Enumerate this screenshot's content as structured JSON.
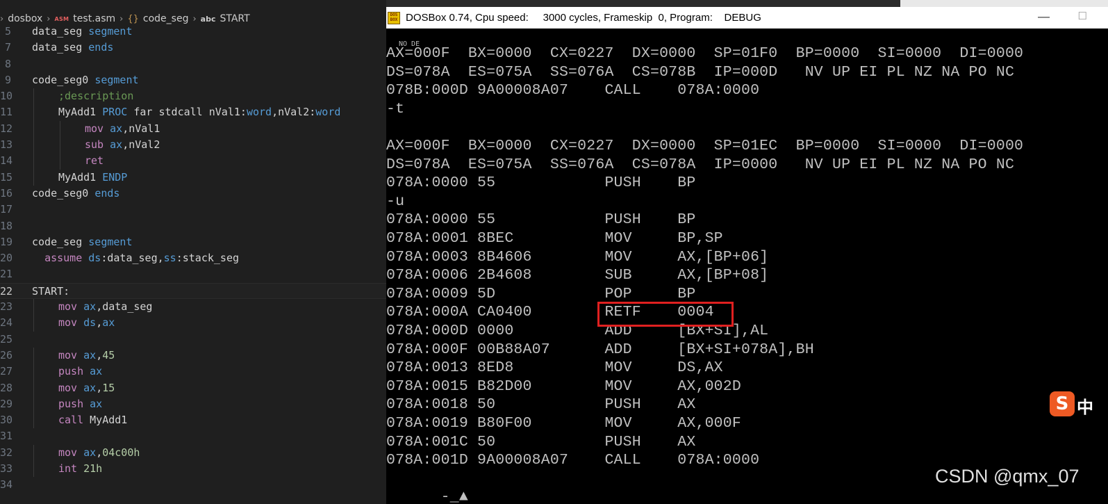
{
  "editor": {
    "breadcrumb": {
      "folder": "dosbox",
      "file_badge": "ASM",
      "file": "test.asm",
      "segment": "code_seg",
      "symbol_badge": "abc",
      "symbol": "START"
    },
    "lines": [
      {
        "num": "5",
        "indent": 0,
        "tokens": [
          {
            "t": "data_seg ",
            "c": "plain"
          },
          {
            "t": "segment",
            "c": "kw"
          }
        ]
      },
      {
        "num": "7",
        "indent": 0,
        "tokens": [
          {
            "t": "data_seg ",
            "c": "plain"
          },
          {
            "t": "ends",
            "c": "kw"
          }
        ]
      },
      {
        "num": "8",
        "indent": 0,
        "tokens": []
      },
      {
        "num": "9",
        "indent": 0,
        "tokens": [
          {
            "t": "code_seg0 ",
            "c": "plain"
          },
          {
            "t": "segment",
            "c": "kw"
          }
        ]
      },
      {
        "num": "10",
        "indent": 1,
        "tokens": [
          {
            "t": ";description",
            "c": "cmt"
          }
        ]
      },
      {
        "num": "11",
        "indent": 1,
        "tokens": [
          {
            "t": "MyAdd1 ",
            "c": "plain"
          },
          {
            "t": "PROC",
            "c": "kw"
          },
          {
            "t": " far stdcall nVal1:",
            "c": "plain"
          },
          {
            "t": "word",
            "c": "kw"
          },
          {
            "t": ",nVal2:",
            "c": "plain"
          },
          {
            "t": "word",
            "c": "kw"
          }
        ]
      },
      {
        "num": "12",
        "indent": 2,
        "tokens": [
          {
            "t": "mov ",
            "c": "ins"
          },
          {
            "t": "ax",
            "c": "reg"
          },
          {
            "t": ",nVal1",
            "c": "plain"
          }
        ]
      },
      {
        "num": "13",
        "indent": 2,
        "tokens": [
          {
            "t": "sub ",
            "c": "ins"
          },
          {
            "t": "ax",
            "c": "reg"
          },
          {
            "t": ",nVal2",
            "c": "plain"
          }
        ]
      },
      {
        "num": "14",
        "indent": 2,
        "tokens": [
          {
            "t": "ret",
            "c": "ins"
          }
        ]
      },
      {
        "num": "15",
        "indent": 1,
        "tokens": [
          {
            "t": "MyAdd1 ",
            "c": "plain"
          },
          {
            "t": "ENDP",
            "c": "kw"
          }
        ]
      },
      {
        "num": "16",
        "indent": 0,
        "tokens": [
          {
            "t": "code_seg0 ",
            "c": "plain"
          },
          {
            "t": "ends",
            "c": "kw"
          }
        ]
      },
      {
        "num": "17",
        "indent": 0,
        "tokens": []
      },
      {
        "num": "18",
        "indent": 0,
        "tokens": []
      },
      {
        "num": "19",
        "indent": 0,
        "tokens": [
          {
            "t": "code_seg ",
            "c": "plain"
          },
          {
            "t": "segment",
            "c": "kw"
          }
        ]
      },
      {
        "num": "20",
        "indent": 0,
        "tokens": [
          {
            "t": "  ",
            "c": "plain"
          },
          {
            "t": "assume ",
            "c": "ins"
          },
          {
            "t": "ds",
            "c": "reg"
          },
          {
            "t": ":data_seg,",
            "c": "plain"
          },
          {
            "t": "ss",
            "c": "reg"
          },
          {
            "t": ":stack_seg",
            "c": "plain"
          }
        ]
      },
      {
        "num": "21",
        "indent": 0,
        "tokens": []
      },
      {
        "num": "22",
        "indent": 0,
        "current": true,
        "tokens": [
          {
            "t": "START:",
            "c": "plain"
          }
        ]
      },
      {
        "num": "23",
        "indent": 1,
        "tokens": [
          {
            "t": "mov ",
            "c": "ins"
          },
          {
            "t": "ax",
            "c": "reg"
          },
          {
            "t": ",data_seg",
            "c": "plain"
          }
        ]
      },
      {
        "num": "24",
        "indent": 1,
        "tokens": [
          {
            "t": "mov ",
            "c": "ins"
          },
          {
            "t": "ds",
            "c": "reg"
          },
          {
            "t": ",",
            "c": "plain"
          },
          {
            "t": "ax",
            "c": "reg"
          }
        ]
      },
      {
        "num": "25",
        "indent": 0,
        "tokens": []
      },
      {
        "num": "26",
        "indent": 1,
        "tokens": [
          {
            "t": "mov ",
            "c": "ins"
          },
          {
            "t": "ax",
            "c": "reg"
          },
          {
            "t": ",",
            "c": "plain"
          },
          {
            "t": "45",
            "c": "num"
          }
        ]
      },
      {
        "num": "27",
        "indent": 1,
        "tokens": [
          {
            "t": "push ",
            "c": "ins"
          },
          {
            "t": "ax",
            "c": "reg"
          }
        ]
      },
      {
        "num": "28",
        "indent": 1,
        "tokens": [
          {
            "t": "mov ",
            "c": "ins"
          },
          {
            "t": "ax",
            "c": "reg"
          },
          {
            "t": ",",
            "c": "plain"
          },
          {
            "t": "15",
            "c": "num"
          }
        ]
      },
      {
        "num": "29",
        "indent": 1,
        "tokens": [
          {
            "t": "push ",
            "c": "ins"
          },
          {
            "t": "ax",
            "c": "reg"
          }
        ]
      },
      {
        "num": "30",
        "indent": 1,
        "tokens": [
          {
            "t": "call ",
            "c": "ins"
          },
          {
            "t": "MyAdd1",
            "c": "plain"
          }
        ]
      },
      {
        "num": "31",
        "indent": 0,
        "tokens": []
      },
      {
        "num": "32",
        "indent": 1,
        "tokens": [
          {
            "t": "mov ",
            "c": "ins"
          },
          {
            "t": "ax",
            "c": "reg"
          },
          {
            "t": ",",
            "c": "plain"
          },
          {
            "t": "04c00h",
            "c": "num"
          }
        ]
      },
      {
        "num": "33",
        "indent": 1,
        "tokens": [
          {
            "t": "int ",
            "c": "ins"
          },
          {
            "t": "21h",
            "c": "num"
          }
        ]
      },
      {
        "num": "34",
        "indent": 0,
        "tokens": []
      }
    ]
  },
  "dosbox": {
    "logo": "DOS BOX",
    "title": "DOSBox 0.74, Cpu speed:     3000 cycles, Frameskip  0, Program:    DEBUG",
    "minimize_glyph": "—",
    "maximize_glyph": "☐",
    "stray_text": "NO DE",
    "screen_lines": [
      "AX=000F  BX=0000  CX=0227  DX=0000  SP=01F0  BP=0000  SI=0000  DI=0000",
      "DS=078A  ES=075A  SS=076A  CS=078B  IP=000D   NV UP EI PL NZ NA PO NC",
      "078B:000D 9A00008A07    CALL    078A:0000",
      "-t",
      "",
      "AX=000F  BX=0000  CX=0227  DX=0000  SP=01EC  BP=0000  SI=0000  DI=0000",
      "DS=078A  ES=075A  SS=076A  CS=078A  IP=0000   NV UP EI PL NZ NA PO NC",
      "078A:0000 55            PUSH    BP",
      "-u",
      "078A:0000 55            PUSH    BP",
      "078A:0001 8BEC          MOV     BP,SP",
      "078A:0003 8B4606        MOV     AX,[BP+06]",
      "078A:0006 2B4608        SUB     AX,[BP+08]",
      "078A:0009 5D            POP     BP",
      "078A:000A CA0400        RETF    0004",
      "078A:000D 0000          ADD     [BX+SI],AL",
      "078A:000F 00B88A07      ADD     [BX+SI+078A],BH",
      "078A:0013 8ED8          MOV     DS,AX",
      "078A:0015 B82D00        MOV     AX,002D",
      "078A:0018 50            PUSH    AX",
      "078A:0019 B80F00        MOV     AX,000F",
      "078A:001C 50            PUSH    AX",
      "078A:001D 9A00008A07    CALL    078A:0000"
    ],
    "prompt": "-",
    "cursor": "_▲"
  },
  "overlay": {
    "ime_icon": "S",
    "ime_lang": "中",
    "watermark": "CSDN @qmx_07"
  },
  "colors": {
    "editor_bg": "#1f1f1f",
    "keyword": "#569cd6",
    "instruction": "#c586c0",
    "comment": "#6a9955",
    "number": "#b5cea8",
    "dos_text": "#c0c0c0",
    "highlight_box": "#e02020",
    "ime": "#ee5a24"
  }
}
